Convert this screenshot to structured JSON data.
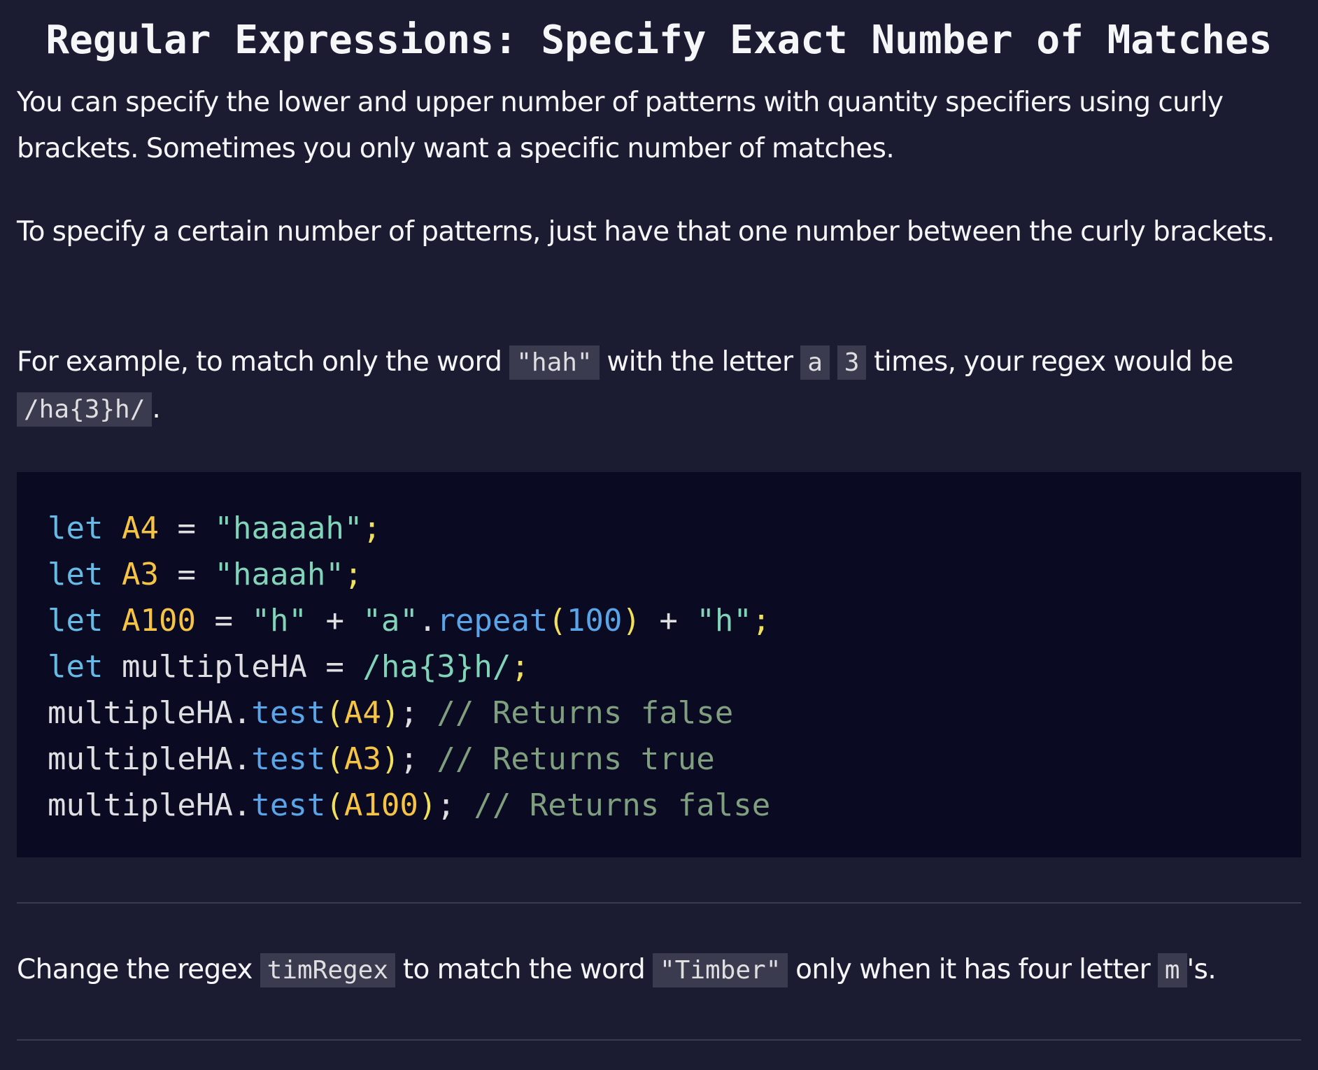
{
  "title": "Regular Expressions: Specify Exact Number of Matches",
  "paragraphs": {
    "p1": "You can specify the lower and upper number of patterns with quantity specifiers using curly brackets. Sometimes you only want a specific number of matches.",
    "p2": "To specify a certain number of patterns, just have that one number between the curly brackets.",
    "p3": {
      "t1": "For example, to match only the word ",
      "c1": "\"hah\"",
      "t2": " with the letter ",
      "c2": "a",
      "t3": " ",
      "c3": "3",
      "t4": " times, your regex would be ",
      "c4": "/ha{3}h/",
      "t5": "."
    },
    "p4": {
      "t1": "Change the regex ",
      "c1": "timRegex",
      "t2": " to match the word ",
      "c2": "\"Timber\"",
      "t3": " only when it has four letter ",
      "c3": "m",
      "t4": "'s."
    }
  },
  "code": {
    "l1": {
      "kw": "let",
      "var": "A4",
      "eq": "=",
      "str": "\"haaaah\"",
      "semi": ";"
    },
    "l2": {
      "kw": "let",
      "var": "A3",
      "eq": "=",
      "str": "\"haaah\"",
      "semi": ";"
    },
    "l3": {
      "kw": "let",
      "var": "A100",
      "eq": "=",
      "s1": "\"h\"",
      "plus1": "+",
      "s2": "\"a\"",
      "dot": ".",
      "fn": "repeat",
      "po": "(",
      "num": "100",
      "pc": ")",
      "plus2": "+",
      "s3": "\"h\"",
      "semi": ";"
    },
    "l4": {
      "kw": "let",
      "var": "multipleHA",
      "eq": "=",
      "rx": "/ha{3}h/",
      "semi": ";"
    },
    "l5": {
      "obj": "multipleHA",
      "dot": ".",
      "fn": "test",
      "po": "(",
      "arg": "A4",
      "pc": ")",
      "semi": ";",
      "cm": "// Returns false"
    },
    "l6": {
      "obj": "multipleHA",
      "dot": ".",
      "fn": "test",
      "po": "(",
      "arg": "A3",
      "pc": ")",
      "semi": ";",
      "cm": "// Returns true"
    },
    "l7": {
      "obj": "multipleHA",
      "dot": ".",
      "fn": "test",
      "po": "(",
      "arg": "A100",
      "pc": ")",
      "semi": ";",
      "cm": "// Returns false"
    }
  }
}
